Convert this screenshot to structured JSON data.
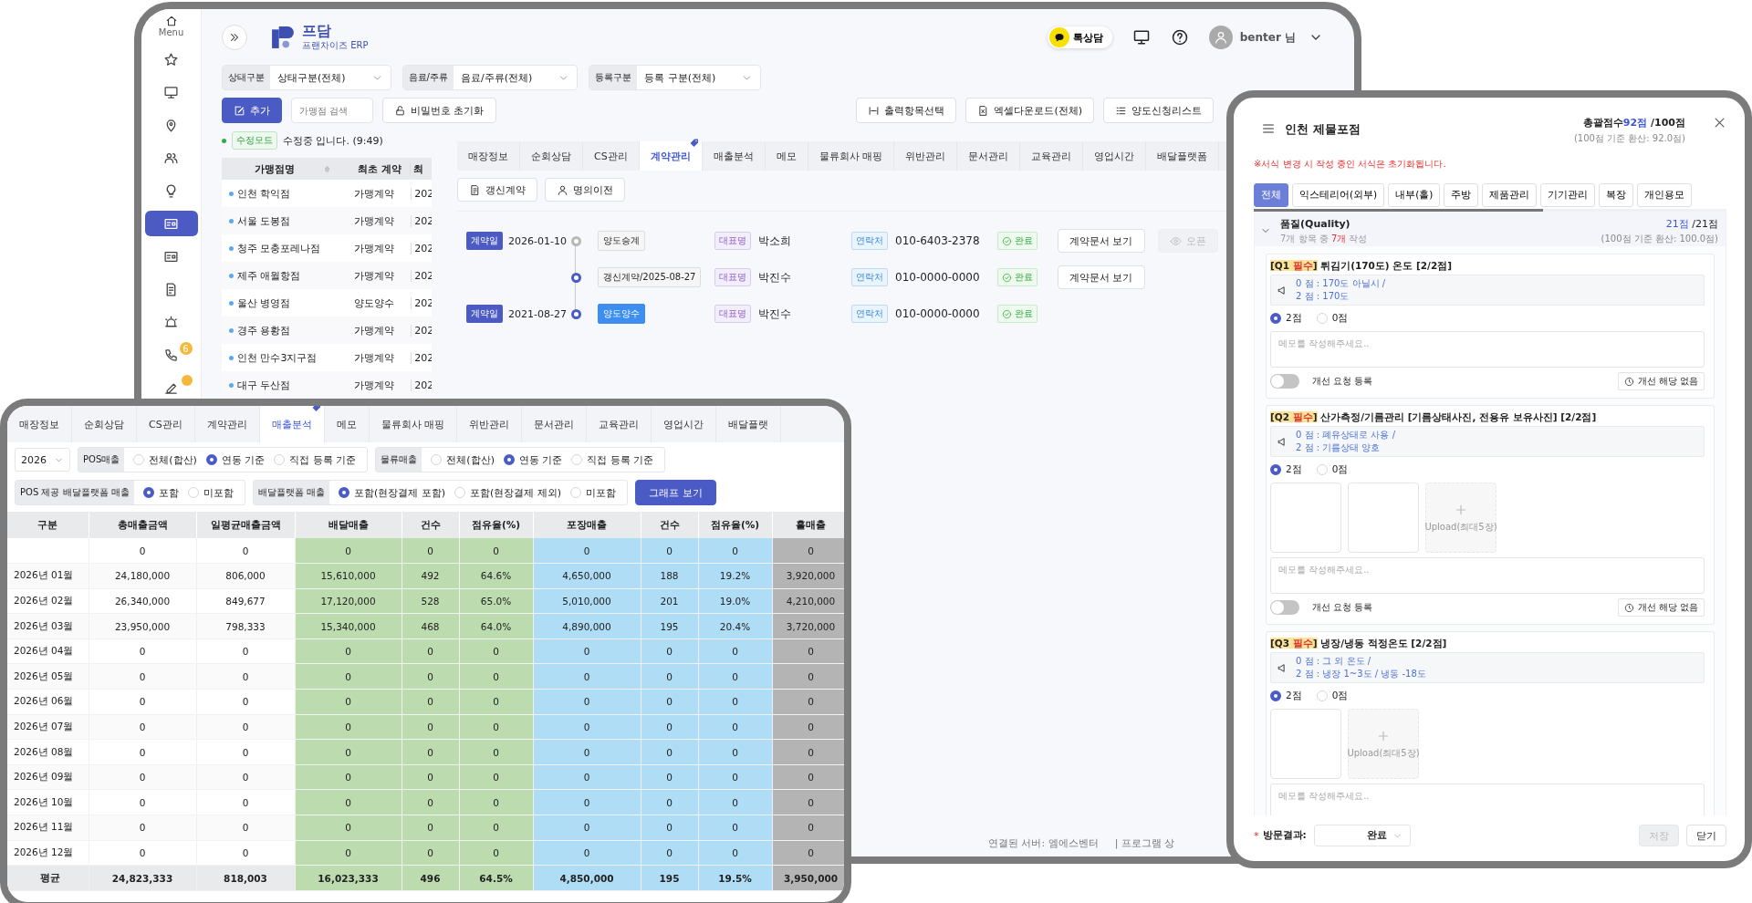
{
  "back_window": {
    "sidebar": {
      "menu_label": "Menu",
      "items": [
        {
          "selected": false
        },
        {
          "selected": false
        },
        {
          "selected": false
        },
        {
          "selected": false
        },
        {
          "selected": false
        },
        {
          "selected": true
        },
        {
          "selected": false
        },
        {
          "selected": false
        },
        {
          "selected": false
        },
        {
          "selected": false,
          "badge": "6"
        },
        {
          "selected": false,
          "dot": true
        }
      ]
    },
    "brand": {
      "name": "프담",
      "tagline": "프랜차이즈 ERP"
    },
    "header": {
      "chat_button": "톡상담",
      "user_name": "benter 님"
    },
    "filters": [
      {
        "label": "상태구분",
        "value": "상태구분(전체)"
      },
      {
        "label": "음료/주류",
        "value": "음료/주류(전체)"
      },
      {
        "label": "등록구분",
        "value": "등록 구분(전체)"
      }
    ],
    "add_button": "추가",
    "search_placeholder": "가맹점 검색",
    "reset_button": "비밀번호 초기화",
    "export_buttons": [
      "출력항목선택",
      "엑셀다운로드(전체)",
      "양도신청리스트"
    ],
    "mode": {
      "badge": "수정모드",
      "message": "수정중 입니다. (9:49)"
    },
    "store_table": {
      "columns": [
        "가맹점명",
        "최초 계약",
        "최"
      ],
      "rows": [
        [
          "인천 학익점",
          "가맹계약",
          "202"
        ],
        [
          "서울 도봉점",
          "가맹계약",
          "202"
        ],
        [
          "청주 모충포레나점",
          "가맹계약",
          "202"
        ],
        [
          "제주 애월항점",
          "가맹계약",
          "202"
        ],
        [
          "울산 병영점",
          "양도양수",
          "202"
        ],
        [
          "경주 용황점",
          "가맹계약",
          "202"
        ],
        [
          "인천 만수3지구점",
          "가맹계약",
          "202"
        ],
        [
          "대구 두산점",
          "가맹계약",
          "202"
        ]
      ]
    },
    "detail_tabs": [
      {
        "label": "매장정보",
        "selected": false
      },
      {
        "label": "순회상담",
        "selected": false
      },
      {
        "label": "CS관리",
        "selected": false
      },
      {
        "label": "계약관리",
        "selected": true
      },
      {
        "label": "매출분석",
        "selected": false
      },
      {
        "label": "메모",
        "selected": false
      },
      {
        "label": "물류회사 매핑",
        "selected": false
      },
      {
        "label": "위반관리",
        "selected": false
      },
      {
        "label": "문서관리",
        "selected": false
      },
      {
        "label": "교육관리",
        "selected": false
      },
      {
        "label": "영업시간",
        "selected": false
      },
      {
        "label": "배달플랫폼",
        "selected": false
      }
    ],
    "contract_actions": [
      "갱신계약",
      "명의이전"
    ],
    "contracts": [
      {
        "date_label": "계약일",
        "date": "2026-01-10",
        "color": "#b8b8b8",
        "type": "양도승계",
        "kind": "outline",
        "rep_label": "대표명",
        "rep": "박소희",
        "phone_label": "연락처",
        "phone": "010-6403-2378",
        "status": "완료",
        "doc_button": "계약문서 보기",
        "open_button": {
          "label": "오픈",
          "disabled": true
        }
      },
      {
        "color": "#4b5bc6",
        "type": "갱신계약/2025-08-27",
        "kind": "outline",
        "rep_label": "대표명",
        "rep": "박진수",
        "phone_label": "연락처",
        "phone": "010-0000-0000",
        "status": "완료",
        "doc_button": "계약문서 보기"
      },
      {
        "date_label": "계약일",
        "date": "2021-08-27",
        "color": "#4b5bc6",
        "type": "양도양수",
        "kind": "filled",
        "rep_label": "대표명",
        "rep": "박진수",
        "phone_label": "연락처",
        "phone": "010-0000-0000",
        "status": "완료"
      }
    ],
    "status_bar": [
      "연결된 서버: 엠에스벤터",
      "| 프로그램 상"
    ]
  },
  "sales_window": {
    "tabs": [
      {
        "label": "매장정보",
        "selected": false
      },
      {
        "label": "순회상담",
        "selected": false
      },
      {
        "label": "CS관리",
        "selected": false
      },
      {
        "label": "계약관리",
        "selected": false
      },
      {
        "label": "매출분석",
        "selected": true
      },
      {
        "label": "메모",
        "selected": false
      },
      {
        "label": "물류회사 매핑",
        "selected": false
      },
      {
        "label": "위반관리",
        "selected": false
      },
      {
        "label": "문서관리",
        "selected": false
      },
      {
        "label": "교육관리",
        "selected": false
      },
      {
        "label": "영업시간",
        "selected": false
      },
      {
        "label": "배달플랫",
        "selected": false
      }
    ],
    "year": "2026",
    "filter_rows": [
      [
        {
          "label": "POS매출",
          "options": [
            {
              "label": "전체(합산)",
              "selected": false
            },
            {
              "label": "연동 기준",
              "selected": true
            },
            {
              "label": "직접 등록 기준",
              "selected": false
            }
          ]
        },
        {
          "label": "물류매출",
          "options": [
            {
              "label": "전체(합산)",
              "selected": false
            },
            {
              "label": "연동 기준",
              "selected": true
            },
            {
              "label": "직접 등록 기준",
              "selected": false
            }
          ]
        }
      ],
      [
        {
          "label": "POS 제공 배달플랫폼 매출",
          "options": [
            {
              "label": "포함",
              "selected": true
            },
            {
              "label": "미포함",
              "selected": false
            }
          ]
        },
        {
          "label": "배달플랫폼 매출",
          "options": [
            {
              "label": "포함(현장결제 포함)",
              "selected": true
            },
            {
              "label": "포함(현장결제 제외)",
              "selected": false
            },
            {
              "label": "미포함",
              "selected": false
            }
          ]
        }
      ]
    ],
    "graph_button": "그래프 보기",
    "table": {
      "columns": [
        {
          "label": "구분"
        },
        {
          "label": "총매출금액"
        },
        {
          "label": "일평균매출금액"
        },
        {
          "label": "배달매출",
          "color": "#bcdcb0"
        },
        {
          "label": "건수",
          "color": "#bcdcb0"
        },
        {
          "label": "점유율(%)",
          "color": "#bcdcb0"
        },
        {
          "label": "포장매출",
          "color": "#b0ddf6"
        },
        {
          "label": "건수",
          "color": "#b0ddf6"
        },
        {
          "label": "점유율(%)",
          "color": "#b0ddf6"
        },
        {
          "label": "홀매출",
          "color": "#b4b4b4"
        }
      ],
      "rows": [
        {
          "cells": [
            "",
            "0",
            "0",
            "0",
            "0",
            "0",
            "0",
            "0",
            "0",
            "0"
          ]
        },
        {
          "cells": [
            "2026년 01월",
            "24,180,000",
            "806,000",
            "15,610,000",
            "492",
            "64.6%",
            "4,650,000",
            "188",
            "19.2%",
            "3,920,000"
          ]
        },
        {
          "cells": [
            "2026년 02월",
            "26,340,000",
            "849,677",
            "17,120,000",
            "528",
            "65.0%",
            "5,010,000",
            "201",
            "19.0%",
            "4,210,000"
          ]
        },
        {
          "cells": [
            "2026년 03월",
            "23,950,000",
            "798,333",
            "15,340,000",
            "468",
            "64.0%",
            "4,890,000",
            "195",
            "20.4%",
            "3,720,000"
          ]
        },
        {
          "cells": [
            "2026년 04월",
            "0",
            "0",
            "0",
            "0",
            "0",
            "0",
            "0",
            "0",
            "0"
          ]
        },
        {
          "cells": [
            "2026년 05월",
            "0",
            "0",
            "0",
            "0",
            "0",
            "0",
            "0",
            "0",
            "0"
          ]
        },
        {
          "cells": [
            "2026년 06월",
            "0",
            "0",
            "0",
            "0",
            "0",
            "0",
            "0",
            "0",
            "0"
          ]
        },
        {
          "cells": [
            "2026년 07월",
            "0",
            "0",
            "0",
            "0",
            "0",
            "0",
            "0",
            "0",
            "0"
          ]
        },
        {
          "cells": [
            "2026년 08월",
            "0",
            "0",
            "0",
            "0",
            "0",
            "0",
            "0",
            "0",
            "0"
          ]
        },
        {
          "cells": [
            "2026년 09월",
            "0",
            "0",
            "0",
            "0",
            "0",
            "0",
            "0",
            "0",
            "0"
          ]
        },
        {
          "cells": [
            "2026년 10월",
            "0",
            "0",
            "0",
            "0",
            "0",
            "0",
            "0",
            "0",
            "0"
          ]
        },
        {
          "cells": [
            "2026년 11월",
            "0",
            "0",
            "0",
            "0",
            "0",
            "0",
            "0",
            "0",
            "0"
          ]
        },
        {
          "cells": [
            "2026년 12월",
            "0",
            "0",
            "0",
            "0",
            "0",
            "0",
            "0",
            "0",
            "0"
          ]
        }
      ],
      "summary": {
        "cells": [
          "평균",
          "24,823,333",
          "818,003",
          "16,023,333",
          "496",
          "64.5%",
          "4,850,000",
          "195",
          "19.5%",
          "3,950,000"
        ]
      }
    }
  },
  "inspection_window": {
    "title": "인천 제물포점",
    "score": {
      "label": "총괄점수",
      "value": "92점",
      "max": "/100점",
      "converted": "(100점 기준 환산: 92.0점)"
    },
    "notice": "※서식 변경 시 작성 중인 서식은 초기화됩니다.",
    "tabs": [
      {
        "label": "전체",
        "selected": true
      },
      {
        "label": "익스테리어(외부)",
        "selected": false
      },
      {
        "label": "내부(홀)",
        "selected": false
      },
      {
        "label": "주방",
        "selected": false
      },
      {
        "label": "제품관리",
        "selected": false
      },
      {
        "label": "기기관리",
        "selected": false
      },
      {
        "label": "복장",
        "selected": false
      },
      {
        "label": "개인용모",
        "selected": false
      }
    ],
    "section": {
      "title": "품질(Quality)",
      "expanded": true,
      "progress_prefix": "7개 항목 중",
      "progress_done": "7개",
      "progress_suffix": "작성",
      "score": "21점",
      "max": "/21점",
      "converted": "(100점 기준 환산: 100.0점)"
    },
    "questions": [
      {
        "badge_open": "[Q1",
        "badge_tag": "필수",
        "badge_close": "]",
        "title": "튀김기(170도) 온도 [2/2점]",
        "criteria": [
          "0 점 : 170도 아닐시 /",
          "2 점 : 170도"
        ],
        "options": [
          {
            "label": "2점",
            "selected": true
          },
          {
            "label": "0점",
            "selected": false
          }
        ],
        "memo_placeholder": "메모를 작성해주세요..",
        "improvement": {
          "label": "개선 요청 등록",
          "on": false,
          "status": "개선 해당 없음"
        }
      },
      {
        "badge_open": "[Q2",
        "badge_tag": "필수",
        "badge_close": "]",
        "title": "산가측정/기름관리 [기름상태사진, 전용유 보유사진] [2/2점]",
        "criteria": [
          "0 점 : 폐유상태로 사용 /",
          "2 점 : 기름상태 양호"
        ],
        "options": [
          {
            "label": "2점",
            "selected": true
          },
          {
            "label": "0점",
            "selected": false
          }
        ],
        "photos": [
          {
            "kind": "empty"
          },
          {
            "kind": "empty"
          }
        ],
        "upload_label": "Upload(최대5장)",
        "memo_placeholder": "메모를 작성해주세요..",
        "improvement": {
          "label": "개선 요청 등록",
          "on": false,
          "status": "개선 해당 없음"
        }
      },
      {
        "badge_open": "[Q3",
        "badge_tag": "필수",
        "badge_close": "]",
        "title": "냉장/냉동 적정온도 [2/2점]",
        "criteria": [
          "0 점 : 그 외 온도 /",
          "2 점 : 냉장 1~3도 / 냉동 -18도"
        ],
        "options": [
          {
            "label": "2점",
            "selected": true
          },
          {
            "label": "0점",
            "selected": false
          }
        ],
        "photos": [
          {
            "kind": "empty"
          }
        ],
        "upload_label": "Upload(최대5장)",
        "memo_placeholder": "메모를 작성해주세요.."
      }
    ],
    "footer": {
      "required_mark": "*",
      "result_label": "방문결과:",
      "result_value": "완료",
      "save_button": {
        "label": "저장",
        "disabled": true
      },
      "close_button": "닫기"
    }
  }
}
